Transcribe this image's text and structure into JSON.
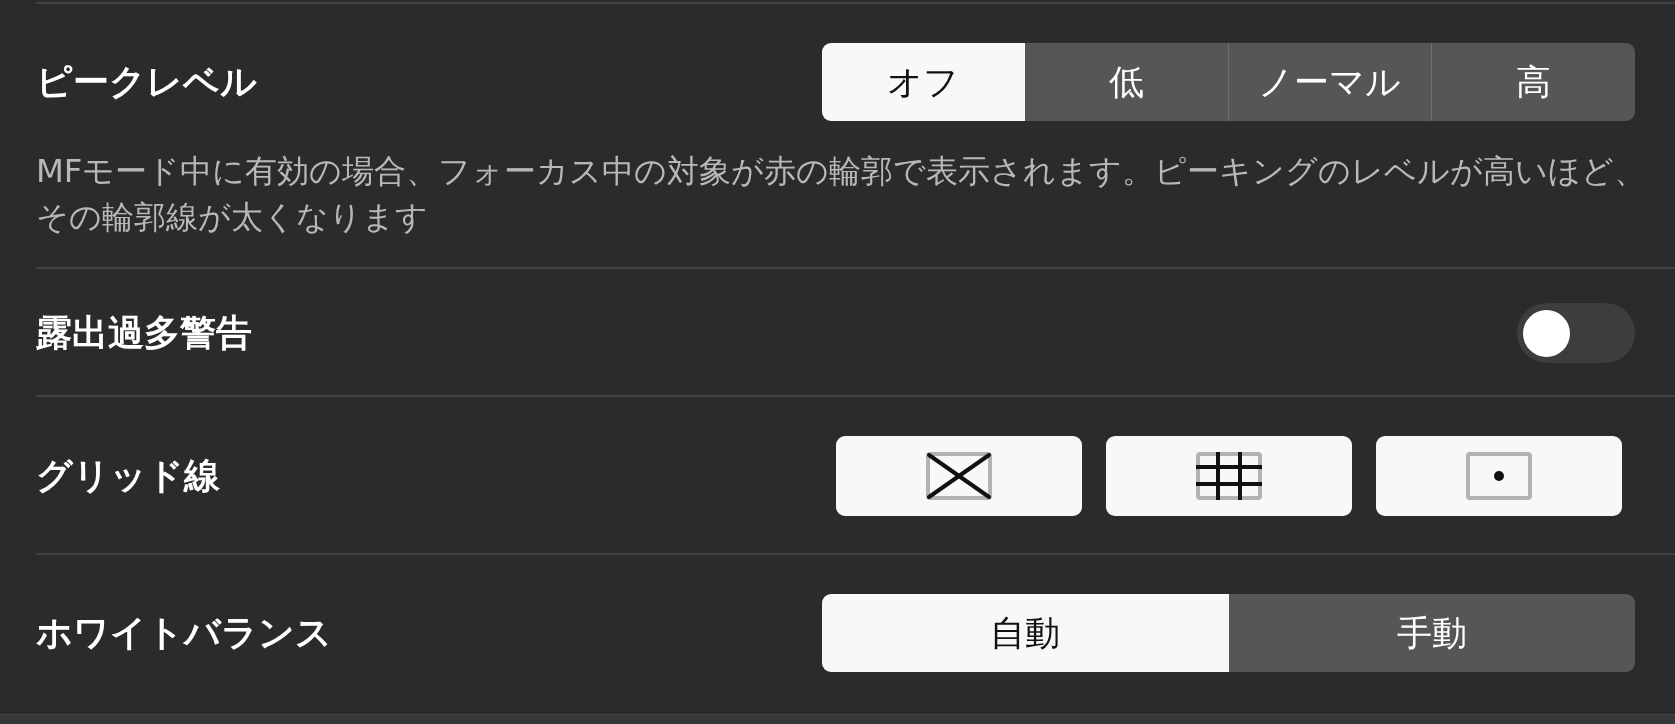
{
  "settings": [
    {
      "kind": "segmented",
      "label": "ピークレベル",
      "options": [
        {
          "label": "オフ",
          "selected": true
        },
        {
          "label": "低",
          "selected": false
        },
        {
          "label": "ノーマル",
          "selected": false
        },
        {
          "label": "高",
          "selected": false
        }
      ],
      "description": "MFモード中に有効の場合、フォーカス中の対象が赤の輪郭で表示されます。ピーキングのレベルが高いほど、その輪郭線が太くなります"
    },
    {
      "kind": "toggle",
      "label": "露出過多警告",
      "on": false
    },
    {
      "kind": "icon_choice",
      "label": "グリッド線",
      "options": [
        {
          "kind": "diagonal"
        },
        {
          "kind": "thirds"
        },
        {
          "kind": "center"
        }
      ]
    },
    {
      "kind": "segmented",
      "label": "ホワイトバランス",
      "options": [
        {
          "label": "自動",
          "selected": true
        },
        {
          "label": "手動",
          "selected": false
        }
      ]
    }
  ]
}
